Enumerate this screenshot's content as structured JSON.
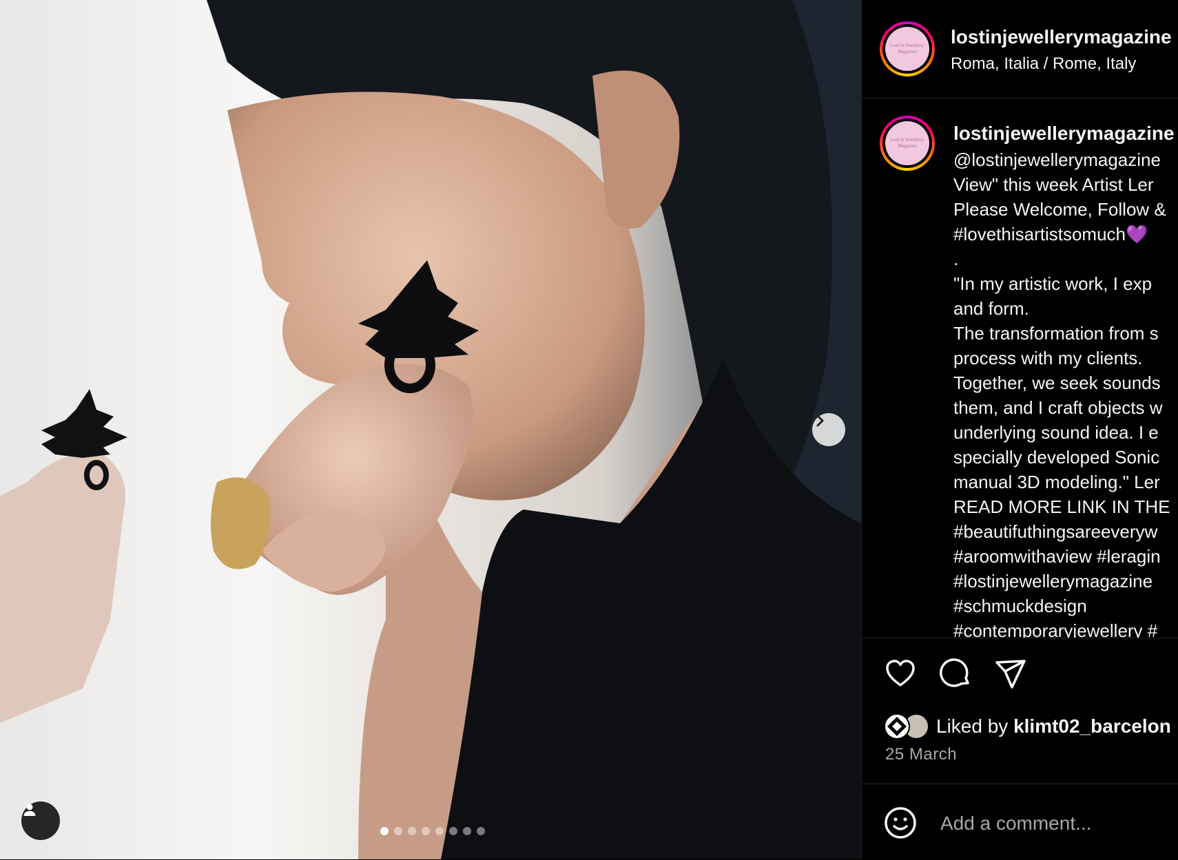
{
  "post": {
    "username": "lostinjewellerymagazine",
    "location": "Roma, Italia / Rome, Italy",
    "avatar_text": "Lost in Jewellery Magazine"
  },
  "caption": {
    "username": "lostinjewellerymagazine",
    "lines": [
      "@lostinjewellerymagazine",
      "View\" this week Artist Ler",
      "Please Welcome, Follow &",
      "#lovethisartistsomuch💜",
      ".",
      "\"In my artistic work, I exp",
      "and form.",
      "The transformation from s",
      "process with my clients.",
      "Together, we seek sounds",
      "them, and I craft objects w",
      "underlying sound idea. I e",
      "specially developed Sonic",
      "manual 3D modeling.\" Ler",
      "READ MORE LINK IN THE",
      "#beautifuthingsareeveryw",
      "#aroomwithaview #leragin",
      "#lostinjewellerymagazine",
      "#schmuckdesign",
      "#contemporaryjewellery #"
    ]
  },
  "likes": {
    "prefix": "Liked by",
    "user": "klimt02_barcelon"
  },
  "date": "25 March",
  "comment": {
    "placeholder": "Add a comment..."
  },
  "carousel": {
    "count": 8,
    "active": 0
  },
  "icons": [
    "chevron-right-icon",
    "user-tag-icon",
    "heart-icon",
    "comment-icon",
    "share-icon",
    "emoji-icon"
  ],
  "colors": {
    "background": "#000000",
    "text": "#f5f5f5",
    "muted": "#a8a8a8",
    "divider": "#262626"
  }
}
